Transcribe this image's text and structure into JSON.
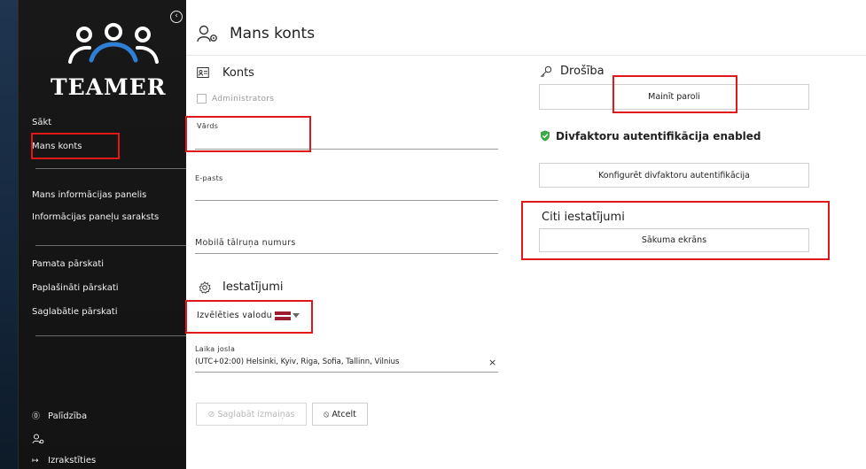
{
  "sidebar": {
    "collapse_glyph": "‹",
    "brand": "TEAMER",
    "items": [
      {
        "label": "Sākt"
      },
      {
        "label": "Mans konts"
      },
      {
        "label": "Mans informācijas panelis"
      },
      {
        "label": "Informācijas paneļu saraksts"
      },
      {
        "label": "Pamata pārskati"
      },
      {
        "label": "Paplašināti pārskati"
      },
      {
        "label": "Saglabātie pārskati"
      }
    ],
    "help": "Palīdzība",
    "logout": "Izrakstīties"
  },
  "page": {
    "title": "Mans konts"
  },
  "account": {
    "section_title": "Konts",
    "admin_label": "Administrators",
    "name_label": "Vārds",
    "email_label": "E-pasts",
    "phone_label": "Mobilā tālruņa numurs"
  },
  "settings": {
    "section_title": "Iestatījumi",
    "language_label": "Izvēlēties valodu",
    "timezone_label": "Laika josla",
    "timezone_value": "(UTC+02:00) Helsinki, Kyiv, Riga, Sofia, Tallinn, Vilnius",
    "clear_glyph": "×",
    "save_label": "Saglabāt izmaiņas",
    "cancel_label": "Atcelt"
  },
  "security": {
    "section_title": "Drošība",
    "change_password": "Mainīt paroli",
    "twofa_status": "Divfaktoru autentifikācija enabled",
    "configure_2fa": "Konfigurēt divfaktoru autentifikācija"
  },
  "other": {
    "section_title": "Citi iestatījumi",
    "home_screen": "Sākuma ekrāns"
  },
  "colors": {
    "highlight": "#e01818",
    "success": "#3aa845",
    "sidebar_bg": "#181818"
  }
}
